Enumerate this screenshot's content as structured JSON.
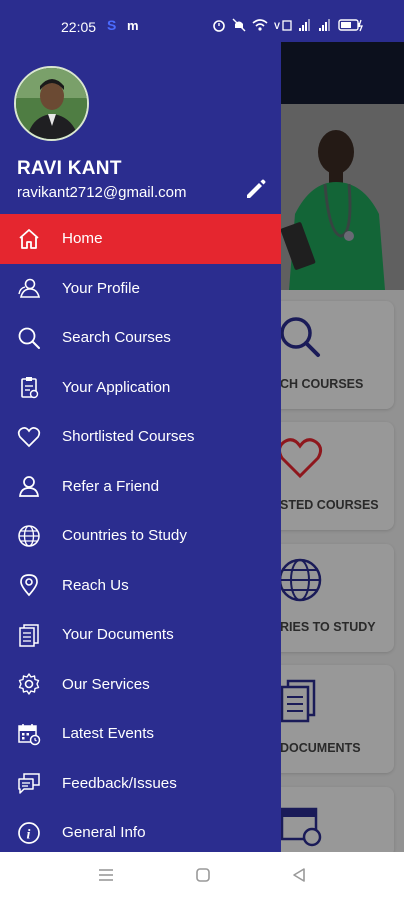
{
  "status_bar": {
    "time": "22:05",
    "s_icon_text": "S",
    "m_icon_text": "m",
    "icons": [
      "alarm-icon",
      "mute-icon",
      "wifi-icon",
      "volte-icon",
      "signal-icon",
      "signal2-icon",
      "battery-icon"
    ]
  },
  "background": {
    "cards": [
      {
        "label": "CH COURSES",
        "icon": "search-icon"
      },
      {
        "label": "STED COURSES",
        "icon": "heart-icon"
      },
      {
        "label": "RIES TO STUDY",
        "icon": "globe-icon"
      },
      {
        "label": "DOCUMENTS",
        "icon": "documents-icon"
      }
    ]
  },
  "user": {
    "name": "RAVI KANT",
    "email": "ravikant2712@gmail.com"
  },
  "menu": [
    {
      "label": "Home",
      "icon": "home-icon",
      "active": true
    },
    {
      "label": "Your Profile",
      "icon": "profile-icon"
    },
    {
      "label": "Search Courses",
      "icon": "search-icon"
    },
    {
      "label": "Your Application",
      "icon": "application-icon"
    },
    {
      "label": "Shortlisted Courses",
      "icon": "heart-icon"
    },
    {
      "label": "Refer a Friend",
      "icon": "person-icon"
    },
    {
      "label": "Countries to Study",
      "icon": "globe-icon"
    },
    {
      "label": "Reach Us",
      "icon": "location-pin-icon"
    },
    {
      "label": "Your Documents",
      "icon": "documents-icon"
    },
    {
      "label": "Our Services",
      "icon": "gear-icon"
    },
    {
      "label": "Latest Events",
      "icon": "calendar-icon"
    },
    {
      "label": "Feedback/Issues",
      "icon": "feedback-icon"
    },
    {
      "label": "General Info",
      "icon": "info-icon"
    }
  ],
  "colors": {
    "drawer_bg": "#2b2d8f",
    "active_bg": "#e5262f",
    "accent": "#2b2d8f"
  }
}
